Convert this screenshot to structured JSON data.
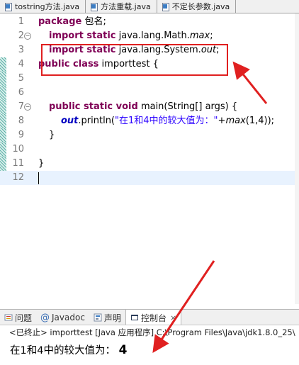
{
  "tabs": [
    {
      "label": "tostring方法.java"
    },
    {
      "label": "方法重载.java"
    },
    {
      "label": "不定长参数.java"
    }
  ],
  "editor": {
    "lines": [
      {
        "num": "1"
      },
      {
        "num": "2"
      },
      {
        "num": "3"
      },
      {
        "num": "4"
      },
      {
        "num": "5"
      },
      {
        "num": "6"
      },
      {
        "num": "7"
      },
      {
        "num": "8"
      },
      {
        "num": "9"
      },
      {
        "num": "10"
      },
      {
        "num": "11"
      },
      {
        "num": "12"
      }
    ],
    "code": {
      "l1_kw": "package",
      "l1_rest": " 包名;",
      "l2_kw": "import static",
      "l2_rest": " java.lang.Math.",
      "l2_it": "max",
      "l2_end": ";",
      "l3_kw": "import static",
      "l3_rest": " java.lang.System.",
      "l3_it": "out",
      "l3_end": ";",
      "l4_kw": "public class",
      "l4_rest": " importtest {",
      "l7_kw": "public static void",
      "l7_rest": " main(String[] args) {",
      "l8_fld": "out",
      "l8_a": ".println(",
      "l8_str": "\"在1和4中的较大值为：\"",
      "l8_b": "+",
      "l8_it": "max",
      "l8_c": "(1,4));",
      "l9": "}",
      "l11": "}"
    }
  },
  "panel": {
    "tabs": [
      {
        "label": "问题"
      },
      {
        "label": "Javadoc"
      },
      {
        "label": "声明"
      },
      {
        "label": "控制台"
      }
    ],
    "close_glyph": "⨯",
    "console_info": "<已终止> importtest [Java 应用程序] C:\\Program Files\\Java\\jdk1.8.0_25\\",
    "output_prefix": "在1和4中的较大值为：",
    "output_value": "4"
  },
  "colors": {
    "annotation_red": "#e02020",
    "keyword": "#7f0055",
    "string": "#2a00ff",
    "field": "#0000c0"
  }
}
